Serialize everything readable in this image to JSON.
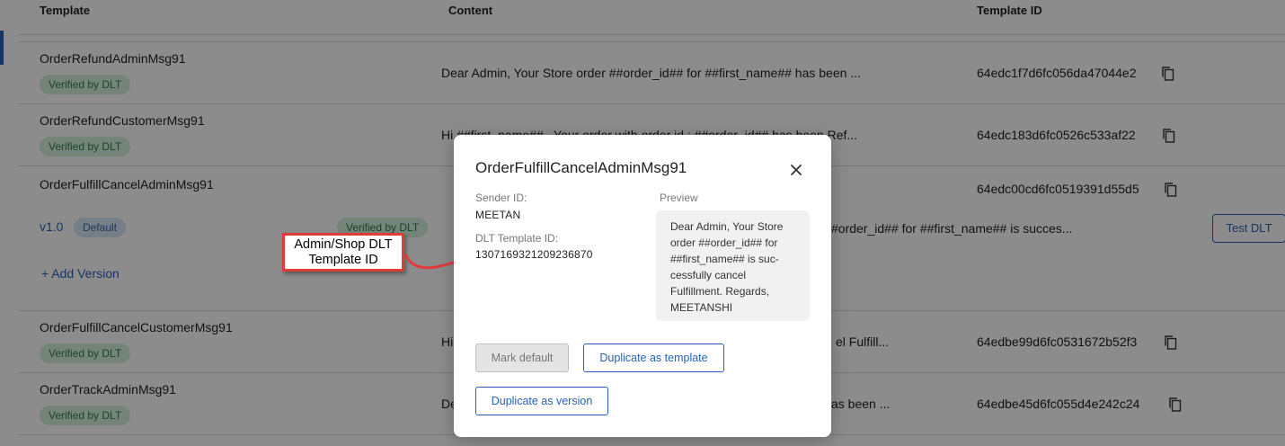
{
  "table": {
    "headers": [
      "Template",
      "Content",
      "Template ID"
    ],
    "rows": [
      {
        "name": "OrderRefundAdminMsg91",
        "badge": "Verified by DLT",
        "content": "Dear Admin, Your Store order ##order_id## for ##first_name## has been ...",
        "template_id": "64edc1f7d6fc056da47044e2"
      },
      {
        "name": "OrderRefundCustomerMsg91",
        "badge": "Verified by DLT",
        "content": "Hi ##first_name## , Your order with order id : ##order_id## has been Ref...",
        "template_id": "64edc183d6fc0526c533af22"
      },
      {
        "name": "OrderFulfillCancelAdminMsg91",
        "template_id": "64edc00cd6fc0519391d55d5",
        "version_label": "v1.0",
        "version_badge": "Default",
        "version_verified": "Verified by DLT",
        "version_content": "#order_id## for ##first_name## is succes...",
        "test_button": "Test DLT",
        "add_version": "+ Add Version"
      },
      {
        "name": "OrderFulfillCancelCustomerMsg91",
        "badge": "Verified by DLT",
        "content": "Hi",
        "content_tail": "el Fulfill...",
        "template_id": "64edbe99d6fc0531672b52f3"
      },
      {
        "name": "OrderTrackAdminMsg91",
        "badge": "Verified by DLT",
        "content": "De",
        "content_tail": "as been ...",
        "template_id": "64edbe45d6fc055d4e242c24"
      }
    ]
  },
  "modal": {
    "title": "OrderFulfillCancelAdminMsg91",
    "sender_id_label": "Sender ID:",
    "sender_id": "MEETAN",
    "dlt_template_id_label": "DLT Template ID:",
    "dlt_template_id": "1307169321209236870",
    "preview_label": "Preview",
    "preview_lines": [
      "Dear Admin, Your Store",
      "order ##order_id## for",
      "##first_name## is suc-",
      "cessfully cancel",
      "Fulfillment. Regards,",
      "MEETANSHI"
    ],
    "mark_default": "Mark default",
    "duplicate_template": "Duplicate as template",
    "duplicate_version": "Duplicate as version"
  },
  "annotation": {
    "line1": "Admin/Shop DLT",
    "line2": "Template ID"
  },
  "icons": {
    "copy": "copy-icon",
    "close": "close-icon"
  },
  "colors": {
    "accent": "#2a62b8",
    "verified_bg": "#d6f0dc",
    "verified_text": "#2e7d4f",
    "callout_border": "#e03c3c"
  }
}
